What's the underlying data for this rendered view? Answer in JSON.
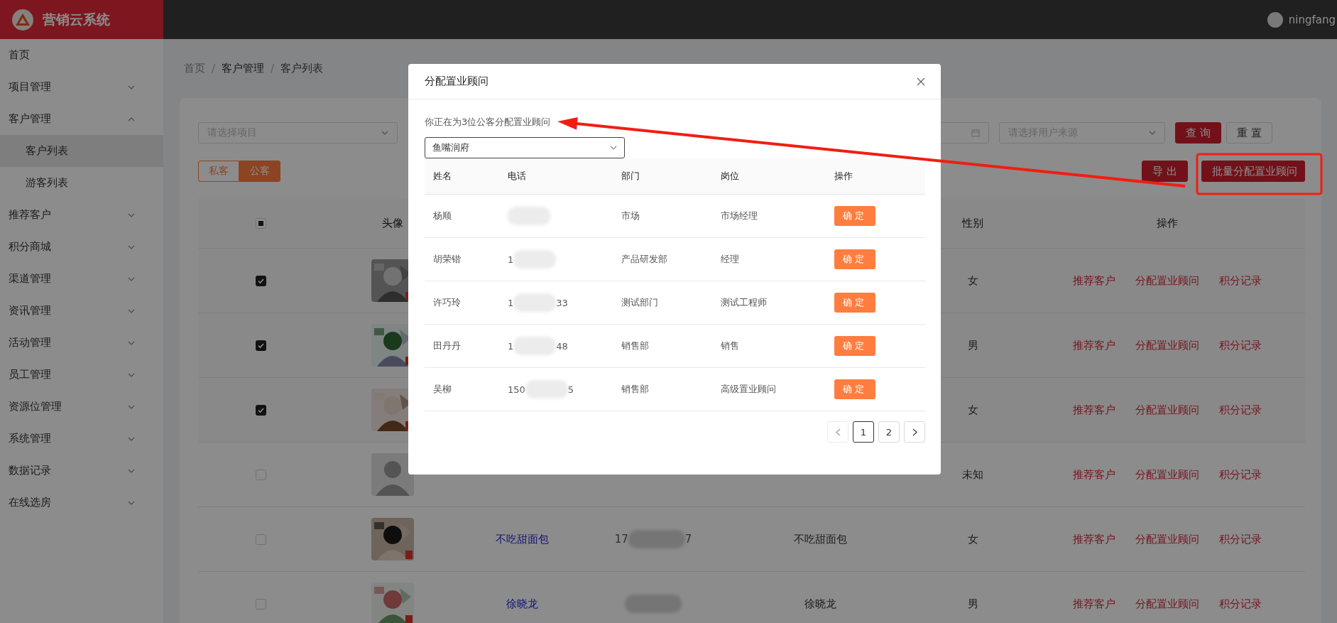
{
  "app": {
    "title": "营销云系统"
  },
  "user": {
    "name": "ningfang"
  },
  "sidebar": {
    "items": [
      {
        "label": "首页",
        "kind": "link"
      },
      {
        "label": "项目管理",
        "kind": "group",
        "expanded": false
      },
      {
        "label": "客户管理",
        "kind": "group",
        "expanded": true,
        "children": [
          {
            "label": "客户列表",
            "selected": true
          },
          {
            "label": "游客列表",
            "selected": false
          }
        ]
      },
      {
        "label": "推荐客户",
        "kind": "group",
        "expanded": false
      },
      {
        "label": "积分商城",
        "kind": "group",
        "expanded": false
      },
      {
        "label": "渠道管理",
        "kind": "group",
        "expanded": false
      },
      {
        "label": "资讯管理",
        "kind": "group",
        "expanded": false
      },
      {
        "label": "活动管理",
        "kind": "group",
        "expanded": false
      },
      {
        "label": "员工管理",
        "kind": "group",
        "expanded": false
      },
      {
        "label": "资源位管理",
        "kind": "group",
        "expanded": false
      },
      {
        "label": "系统管理",
        "kind": "group",
        "expanded": false
      },
      {
        "label": "数据记录",
        "kind": "group",
        "expanded": false
      },
      {
        "label": "在线选房",
        "kind": "group",
        "expanded": false
      }
    ]
  },
  "breadcrumb": [
    {
      "label": "首页",
      "kind": "link"
    },
    {
      "label": "/",
      "kind": "separator"
    },
    {
      "label": "客户管理",
      "kind": "link"
    },
    {
      "label": "/",
      "kind": "separator"
    },
    {
      "label": "客户列表",
      "kind": "current"
    }
  ],
  "filters": {
    "project": {
      "placeholder": "请选择项目"
    },
    "source": {
      "placeholder": "请选择用户来源"
    },
    "buttons": [
      {
        "label": "查询",
        "kind": "primary"
      },
      {
        "label": "重置",
        "kind": "default"
      }
    ]
  },
  "tabs": [
    {
      "label": "私客",
      "selected": false
    },
    {
      "label": "公客",
      "selected": true
    }
  ],
  "actions": [
    {
      "label": "导出"
    },
    {
      "label": "批量分配置业顾问"
    }
  ],
  "table": {
    "select_all_indeterminate": true,
    "header": {
      "avatar": "头像",
      "gender": "性别",
      "actions": "操作"
    },
    "rows": [
      {
        "checked": true,
        "gender": "女",
        "actions": [
          "推荐客户",
          "分配置业顾问",
          "积分记录"
        ]
      },
      {
        "checked": true,
        "gender": "男",
        "actions": [
          "推荐客户",
          "分配置业顾问",
          "积分记录"
        ]
      },
      {
        "checked": true,
        "gender": "女",
        "actions": [
          "推荐客户",
          "分配置业顾问",
          "积分记录"
        ]
      },
      {
        "checked": false,
        "avatar": {
          "kind": "placeholder"
        },
        "gender": "未知",
        "actions": [
          "推荐客户",
          "分配置业顾问",
          "积分记录"
        ]
      },
      {
        "checked": false,
        "name": "不吃甜面包",
        "phone_start": "17",
        "phone_end": "7",
        "nickname": "不吃甜面包",
        "gender": "女",
        "actions": [
          "推荐客户",
          "分配置业顾问",
          "积分记录"
        ]
      },
      {
        "checked": false,
        "name": "徐晓龙",
        "nickname": "徐晓龙",
        "gender": "男",
        "actions": [
          "推荐客户",
          "分配置业顾问",
          "积分记录"
        ]
      }
    ]
  },
  "modal": {
    "title": "分配置业顾问",
    "message": "你正在为3位公客分配置业顾问",
    "project": {
      "value": "鱼嘴润府"
    },
    "columns": [
      "姓名",
      "电话",
      "部门",
      "岗位",
      "操作"
    ],
    "rows": [
      {
        "name": "杨顺",
        "department": "市场",
        "position": "市场经理",
        "action": "确定"
      },
      {
        "name": "胡荣锴",
        "phone_start": "1",
        "department": "产品研发部",
        "position": "经理",
        "action": "确定"
      },
      {
        "name": "许巧玲",
        "phone_start": "1",
        "phone_end": "33",
        "department": "测试部门",
        "position": "测试工程师",
        "action": "确定"
      },
      {
        "name": "田丹丹",
        "phone_start": "1",
        "phone_end": "48",
        "department": "销售部",
        "position": "销售",
        "action": "确定"
      },
      {
        "name": "吴柳",
        "phone_start": "150",
        "phone_end": "5",
        "department": "销售部",
        "position": "高级置业顾问",
        "action": "确定"
      }
    ],
    "pagination": {
      "prev_disabled": true,
      "next_disabled": false,
      "pages": [
        {
          "label": "1",
          "selected": true
        },
        {
          "label": "2",
          "selected": false
        }
      ]
    }
  }
}
